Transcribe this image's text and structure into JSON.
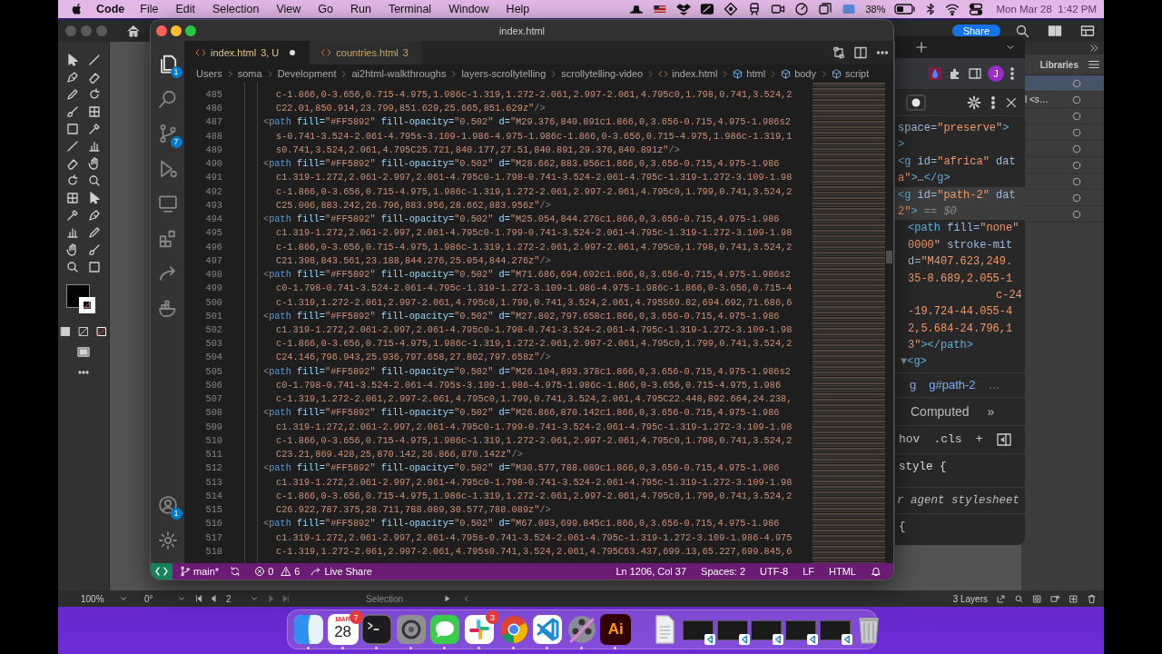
{
  "menu_bar": {
    "app": "Code",
    "menus": [
      "File",
      "Edit",
      "Selection",
      "View",
      "Go",
      "Run",
      "Terminal",
      "Window",
      "Help"
    ],
    "battery": "38%",
    "clock": "Mon Mar 28  1:42 PM"
  },
  "illustrator": {
    "share": "Share",
    "panel_title": "Libraries",
    "layers": [
      {
        "selected": true
      },
      {
        "label": "l <s…",
        "selected": false
      },
      {
        "selected": false
      },
      {
        "selected": false
      },
      {
        "selected": false
      },
      {
        "selected": false
      },
      {
        "selected": false
      },
      {
        "selected": false
      },
      {
        "selected": false
      }
    ],
    "status": {
      "zoom": "100%",
      "rotation": "0°",
      "artboard": "2",
      "tool": "Selection",
      "layers_count": "3 Layers"
    }
  },
  "browser": {
    "avatar": "J",
    "dom_lines": [
      {
        "kind": "root",
        "selected": false,
        "tokens": [
          {
            "kind": "attr",
            "text": "space="
          },
          {
            "kind": "value",
            "text": "\"preserve\""
          },
          {
            "kind": "tag",
            "text": ">"
          }
        ]
      },
      {
        "kind": "root",
        "selected": false,
        "tokens": [
          {
            "kind": "tag",
            "text": ">"
          }
        ]
      },
      {
        "kind": "root",
        "selected": false,
        "tokens": [
          {
            "kind": "tag",
            "text": "<g"
          },
          {
            "kind": "attr",
            "text": " id="
          },
          {
            "kind": "value",
            "text": "\"africa\""
          },
          {
            "kind": "attr",
            "text": " dat"
          }
        ]
      },
      {
        "kind": "root",
        "selected": false,
        "tokens": [
          {
            "kind": "value",
            "text": "a\""
          },
          {
            "kind": "tag",
            "text": ">"
          },
          {
            "kind": "punct",
            "text": "…"
          },
          {
            "kind": "tag",
            "text": "</g>"
          }
        ]
      },
      {
        "kind": "root",
        "selected": true,
        "tokens": [
          {
            "kind": "tag",
            "text": "<g"
          },
          {
            "kind": "attr",
            "text": " id="
          },
          {
            "kind": "value",
            "text": "\"path-2\""
          },
          {
            "kind": "attr",
            "text": " dat"
          }
        ]
      },
      {
        "kind": "root",
        "selected": true,
        "tokens": [
          {
            "kind": "value",
            "text": "2\""
          },
          {
            "kind": "tag",
            "text": ">"
          },
          {
            "kind": "note",
            "text": " == $0"
          }
        ]
      },
      {
        "kind": "child",
        "selected": false,
        "tokens": [
          {
            "kind": "tag",
            "text": "<path"
          },
          {
            "kind": "attr",
            "text": " fill="
          },
          {
            "kind": "value",
            "text": "\"none\""
          }
        ]
      },
      {
        "kind": "child",
        "selected": false,
        "tokens": [
          {
            "kind": "value",
            "text": "0000\""
          },
          {
            "kind": "attr",
            "text": " stroke-mit"
          }
        ]
      },
      {
        "kind": "child",
        "selected": false,
        "tokens": [
          {
            "kind": "attr",
            "text": "d="
          },
          {
            "kind": "value",
            "text": "\"M407.623,249."
          }
        ]
      },
      {
        "kind": "child",
        "selected": false,
        "tokens": [
          {
            "kind": "value",
            "text": "35-8.689,2.055-1"
          }
        ]
      },
      {
        "kind": "deep",
        "selected": false,
        "tokens": [
          {
            "kind": "value",
            "text": "c-24"
          }
        ]
      },
      {
        "kind": "child",
        "selected": false,
        "tokens": [
          {
            "kind": "value",
            "text": "-19.724-44.055-4"
          }
        ]
      },
      {
        "kind": "child",
        "selected": false,
        "tokens": [
          {
            "kind": "value",
            "text": "2,5.684-24.796,1"
          }
        ]
      },
      {
        "kind": "child",
        "selected": false,
        "tokens": [
          {
            "kind": "value",
            "text": "3\""
          },
          {
            "kind": "tag",
            "text": "></path>"
          }
        ]
      },
      {
        "kind": "arrow",
        "selected": false,
        "tokens": [
          {
            "kind": "note",
            "text": "▼"
          },
          {
            "kind": "tag",
            "text": "<g>"
          }
        ]
      }
    ],
    "crumbs": [
      "g",
      "g#path-2",
      "…"
    ],
    "pane_tab": "Computed",
    "pane_more": "»",
    "style_tools": [
      "hov",
      ".cls",
      "+"
    ],
    "style_lines": [
      {
        "kind": "rule",
        "text": "style {"
      },
      {
        "kind": "source",
        "text": "r agent stylesheet"
      },
      {
        "kind": "rule",
        "text": "{"
      }
    ]
  },
  "editor": {
    "title": "index.html",
    "activity": [
      {
        "kind": "explorer",
        "selected": true,
        "badge": "1"
      },
      {
        "kind": "search",
        "selected": false
      },
      {
        "kind": "source-control",
        "selected": false,
        "badge": "7"
      },
      {
        "kind": "run",
        "selected": false
      },
      {
        "kind": "remote",
        "selected": false
      },
      {
        "kind": "extensions",
        "selected": false
      },
      {
        "kind": "live-share",
        "selected": false
      },
      {
        "kind": "docker",
        "selected": false
      }
    ],
    "activity_bottom": [
      {
        "kind": "accounts",
        "badge": "1"
      },
      {
        "kind": "manage"
      }
    ],
    "tabs": [
      {
        "label": "index.html",
        "detail": "3, U",
        "modified": true,
        "selected": true
      },
      {
        "label": "countries.html",
        "detail": "3",
        "modified": false,
        "selected": false
      }
    ],
    "breadcrumbs": [
      {
        "kind": "folder",
        "label": "Users"
      },
      {
        "kind": "folder",
        "label": "soma"
      },
      {
        "kind": "folder",
        "label": "Development"
      },
      {
        "kind": "folder",
        "label": "ai2html-walkthroughs"
      },
      {
        "kind": "folder",
        "label": "layers-scrollytelling"
      },
      {
        "kind": "folder",
        "label": "scrollytelling-video"
      },
      {
        "kind": "file",
        "label": "index.html"
      },
      {
        "kind": "element",
        "label": "html"
      },
      {
        "kind": "element",
        "label": "body"
      },
      {
        "kind": "element",
        "label": "script"
      }
    ],
    "lines": [
      {
        "n": "485",
        "kind": "cont",
        "tokens": [
          {
            "kind": "value",
            "text": "c-1.866,0-3.656,0.715-4.975,1.986c-1.319,1.272-2.061,2.997-2.061,4.795c0,1.798,0.741,3.524,2"
          }
        ]
      },
      {
        "n": "486",
        "kind": "cont",
        "tokens": [
          {
            "kind": "value",
            "text": "C22.01,850.914,23.799,851.629,25.665,851.629z\""
          },
          {
            "kind": "punct",
            "text": "/>"
          }
        ]
      },
      {
        "n": "487",
        "kind": "open",
        "tokens": [
          {
            "kind": "punct",
            "text": "<"
          },
          {
            "kind": "tag",
            "text": "path"
          },
          {
            "kind": "attr",
            "text": " fill="
          },
          {
            "kind": "value",
            "text": "\"#FF5892\""
          },
          {
            "kind": "attr",
            "text": " fill-opacity="
          },
          {
            "kind": "value",
            "text": "\"0.502\""
          },
          {
            "kind": "attr",
            "text": " d="
          },
          {
            "kind": "value",
            "text": "\"M29.376,840.891c1.866,0,3.656-0.715,4.975-1.986s2"
          }
        ]
      },
      {
        "n": "488",
        "kind": "cont",
        "tokens": [
          {
            "kind": "value",
            "text": "s-0.741-3.524-2.061-4.795s-3.109-1.986-4.975-1.986c-1.866,0-3.656,0.715-4.975,1.986c-1.319,1"
          }
        ]
      },
      {
        "n": "489",
        "kind": "cont",
        "tokens": [
          {
            "kind": "value",
            "text": "s0.741,3.524,2.061,4.795C25.721,840.177,27.51,840.891,29.376,840.891z\""
          },
          {
            "kind": "punct",
            "text": "/>"
          }
        ]
      },
      {
        "n": "490",
        "kind": "open",
        "tokens": [
          {
            "kind": "punct",
            "text": "<"
          },
          {
            "kind": "tag",
            "text": "path"
          },
          {
            "kind": "attr",
            "text": " fill="
          },
          {
            "kind": "value",
            "text": "\"#FF5892\""
          },
          {
            "kind": "attr",
            "text": " fill-opacity="
          },
          {
            "kind": "value",
            "text": "\"0.502\""
          },
          {
            "kind": "attr",
            "text": " d="
          },
          {
            "kind": "value",
            "text": "\"M28.662,883.956c1.866,0,3.656-0.715,4.975-1.986"
          }
        ]
      },
      {
        "n": "491",
        "kind": "cont",
        "tokens": [
          {
            "kind": "value",
            "text": "c1.319-1.272,2.061-2.997,2.061-4.795c0-1.798-0.741-3.524-2.061-4.795c-1.319-1.272-3.109-1.98"
          }
        ]
      },
      {
        "n": "492",
        "kind": "cont",
        "tokens": [
          {
            "kind": "value",
            "text": "c-1.866,0-3.656,0.715-4.975,1.986c-1.319,1.272-2.061,2.997-2.061,4.795c0,1.799,0.741,3.524,2"
          }
        ]
      },
      {
        "n": "493",
        "kind": "cont",
        "tokens": [
          {
            "kind": "value",
            "text": "C25.006,883.242,26.796,883.956,28.662,883.956z\""
          },
          {
            "kind": "punct",
            "text": "/>"
          }
        ]
      },
      {
        "n": "494",
        "kind": "open",
        "tokens": [
          {
            "kind": "punct",
            "text": "<"
          },
          {
            "kind": "tag",
            "text": "path"
          },
          {
            "kind": "attr",
            "text": " fill="
          },
          {
            "kind": "value",
            "text": "\"#FF5892\""
          },
          {
            "kind": "attr",
            "text": " fill-opacity="
          },
          {
            "kind": "value",
            "text": "\"0.502\""
          },
          {
            "kind": "attr",
            "text": " d="
          },
          {
            "kind": "value",
            "text": "\"M25.054,844.276c1.866,0,3.656-0.715,4.975-1.986"
          }
        ]
      },
      {
        "n": "495",
        "kind": "cont",
        "tokens": [
          {
            "kind": "value",
            "text": "c1.319-1.272,2.061-2.997,2.061-4.795c0-1.799-0.741-3.524-2.061-4.795c-1.319-1.272-3.109-1.98"
          }
        ]
      },
      {
        "n": "496",
        "kind": "cont",
        "tokens": [
          {
            "kind": "value",
            "text": "c-1.866,0-3.656,0.715-4.975,1.986c-1.319,1.272-2.061,2.997-2.061,4.795c0,1.798,0.741,3.524,2"
          }
        ]
      },
      {
        "n": "497",
        "kind": "cont",
        "tokens": [
          {
            "kind": "value",
            "text": "C21.398,843.561,23.188,844.276,25.054,844.276z\""
          },
          {
            "kind": "punct",
            "text": "/>"
          }
        ]
      },
      {
        "n": "498",
        "kind": "open",
        "tokens": [
          {
            "kind": "punct",
            "text": "<"
          },
          {
            "kind": "tag",
            "text": "path"
          },
          {
            "kind": "attr",
            "text": " fill="
          },
          {
            "kind": "value",
            "text": "\"#FF5892\""
          },
          {
            "kind": "attr",
            "text": " fill-opacity="
          },
          {
            "kind": "value",
            "text": "\"0.502\""
          },
          {
            "kind": "attr",
            "text": " d="
          },
          {
            "kind": "value",
            "text": "\"M71.686,694.692c1.866,0,3.656-0.715,4.975-1.986s2"
          }
        ]
      },
      {
        "n": "499",
        "kind": "cont",
        "tokens": [
          {
            "kind": "value",
            "text": "c0-1.798-0.741-3.524-2.061-4.795c-1.319-1.272-3.109-1.986-4.975-1.986c-1.866,0-3.656,0.715-4"
          }
        ]
      },
      {
        "n": "500",
        "kind": "cont",
        "tokens": [
          {
            "kind": "value",
            "text": "c-1.319,1.272-2.061,2.997-2.061,4.795c0,1.799,0.741,3.524,2.061,4.795S69.82,694.692,71.686,6"
          }
        ]
      },
      {
        "n": "501",
        "kind": "open",
        "tokens": [
          {
            "kind": "punct",
            "text": "<"
          },
          {
            "kind": "tag",
            "text": "path"
          },
          {
            "kind": "attr",
            "text": " fill="
          },
          {
            "kind": "value",
            "text": "\"#FF5892\""
          },
          {
            "kind": "attr",
            "text": " fill-opacity="
          },
          {
            "kind": "value",
            "text": "\"0.502\""
          },
          {
            "kind": "attr",
            "text": " d="
          },
          {
            "kind": "value",
            "text": "\"M27.802,797.658c1.866,0,3.656-0.715,4.975-1.986"
          }
        ]
      },
      {
        "n": "502",
        "kind": "cont",
        "tokens": [
          {
            "kind": "value",
            "text": "c1.319-1.272,2.061-2.997,2.061-4.795c0-1.798-0.741-3.524-2.061-4.795c-1.319-1.272-3.109-1.98"
          }
        ]
      },
      {
        "n": "503",
        "kind": "cont",
        "tokens": [
          {
            "kind": "value",
            "text": "c-1.866,0-3.656,0.715-4.975,1.986c-1.319,1.272-2.061,2.997-2.061,4.795c0,1.799,0.741,3.524,2"
          }
        ]
      },
      {
        "n": "504",
        "kind": "cont",
        "tokens": [
          {
            "kind": "value",
            "text": "C24.146,796.943,25.936,797.658,27.802,797.658z\""
          },
          {
            "kind": "punct",
            "text": "/>"
          }
        ]
      },
      {
        "n": "505",
        "kind": "open",
        "tokens": [
          {
            "kind": "punct",
            "text": "<"
          },
          {
            "kind": "tag",
            "text": "path"
          },
          {
            "kind": "attr",
            "text": " fill="
          },
          {
            "kind": "value",
            "text": "\"#FF5892\""
          },
          {
            "kind": "attr",
            "text": " fill-opacity="
          },
          {
            "kind": "value",
            "text": "\"0.502\""
          },
          {
            "kind": "attr",
            "text": " d="
          },
          {
            "kind": "value",
            "text": "\"M26.104,893.378c1.866,0,3.656-0.715,4.975-1.986s2"
          }
        ]
      },
      {
        "n": "506",
        "kind": "cont",
        "tokens": [
          {
            "kind": "value",
            "text": "c0-1.798-0.741-3.524-2.061-4.795s-3.109-1.986-4.975-1.986c-1.866,0-3.656,0.715-4.975,1.986"
          }
        ]
      },
      {
        "n": "507",
        "kind": "cont",
        "tokens": [
          {
            "kind": "value",
            "text": "c-1.319,1.272-2.061,2.997-2.061,4.795c0,1.799,0.741,3.524,2.061,4.795C22.448,892.664,24.238,"
          }
        ]
      },
      {
        "n": "508",
        "kind": "open",
        "tokens": [
          {
            "kind": "punct",
            "text": "<"
          },
          {
            "kind": "tag",
            "text": "path"
          },
          {
            "kind": "attr",
            "text": " fill="
          },
          {
            "kind": "value",
            "text": "\"#FF5892\""
          },
          {
            "kind": "attr",
            "text": " fill-opacity="
          },
          {
            "kind": "value",
            "text": "\"0.502\""
          },
          {
            "kind": "attr",
            "text": " d="
          },
          {
            "kind": "value",
            "text": "\"M26.866,870.142c1.866,0,3.656-0.715,4.975-1.986"
          }
        ]
      },
      {
        "n": "509",
        "kind": "cont",
        "tokens": [
          {
            "kind": "value",
            "text": "c1.319-1.272,2.061-2.997,2.061-4.795c0-1.799-0.741-3.524-2.061-4.795c-1.319-1.272-3.109-1.98"
          }
        ]
      },
      {
        "n": "510",
        "kind": "cont",
        "tokens": [
          {
            "kind": "value",
            "text": "c-1.866,0-3.656,0.715-4.975,1.986c-1.319,1.272-2.061,2.997-2.061,4.795c0,1.798,0.741,3.524,2"
          }
        ]
      },
      {
        "n": "511",
        "kind": "cont",
        "tokens": [
          {
            "kind": "value",
            "text": "C23.21,869.428,25,870.142,26.866,870.142z\""
          },
          {
            "kind": "punct",
            "text": "/>"
          }
        ]
      },
      {
        "n": "512",
        "kind": "open",
        "tokens": [
          {
            "kind": "punct",
            "text": "<"
          },
          {
            "kind": "tag",
            "text": "path"
          },
          {
            "kind": "attr",
            "text": " fill="
          },
          {
            "kind": "value",
            "text": "\"#FF5892\""
          },
          {
            "kind": "attr",
            "text": " fill-opacity="
          },
          {
            "kind": "value",
            "text": "\"0.502\""
          },
          {
            "kind": "attr",
            "text": " d="
          },
          {
            "kind": "value",
            "text": "\"M30.577,788.089c1.866,0,3.656-0.715,4.975-1.986"
          }
        ]
      },
      {
        "n": "513",
        "kind": "cont",
        "tokens": [
          {
            "kind": "value",
            "text": "c1.319-1.272,2.061-2.997,2.061-4.795c0-1.798-0.741-3.524-2.061-4.795c-1.319-1.272-3.109-1.98"
          }
        ]
      },
      {
        "n": "514",
        "kind": "cont",
        "tokens": [
          {
            "kind": "value",
            "text": "c-1.866,0-3.656,0.715-4.975,1.986c-1.319,1.272-2.061,2.997-2.061,4.795c0,1.799,0.741,3.524,2"
          }
        ]
      },
      {
        "n": "515",
        "kind": "cont",
        "tokens": [
          {
            "kind": "value",
            "text": "C26.922,787.375,28.711,788.089,30.577,788.089z\""
          },
          {
            "kind": "punct",
            "text": "/>"
          }
        ]
      },
      {
        "n": "516",
        "kind": "open",
        "tokens": [
          {
            "kind": "punct",
            "text": "<"
          },
          {
            "kind": "tag",
            "text": "path"
          },
          {
            "kind": "attr",
            "text": " fill="
          },
          {
            "kind": "value",
            "text": "\"#FF5892\""
          },
          {
            "kind": "attr",
            "text": " fill-opacity="
          },
          {
            "kind": "value",
            "text": "\"0.502\""
          },
          {
            "kind": "attr",
            "text": " d="
          },
          {
            "kind": "value",
            "text": "\"M67.093,699.845c1.866,0,3.656-0.715,4.975-1.986"
          }
        ]
      },
      {
        "n": "517",
        "kind": "cont",
        "tokens": [
          {
            "kind": "value",
            "text": "c1.319-1.272,2.061-2.997,2.061-4.795s-0.741-3.524-2.061-4.795c-1.319-1.272-3.109-1.986-4.975"
          }
        ]
      },
      {
        "n": "518",
        "kind": "cont",
        "tokens": [
          {
            "kind": "value",
            "text": "c-1.319,1.272-2.061,2.997-2.061,4.795s0.741,3.524,2.061,4.795C63.437,699.13,65.227,699.845,6"
          }
        ]
      }
    ],
    "status_bar": {
      "branch": "main*",
      "errors": "0",
      "warnings": "6",
      "live_share": "Live Share",
      "position": "Ln 1206, Col 37",
      "spaces": "Spaces: 2",
      "encoding": "UTF-8",
      "eol": "LF",
      "language": "HTML"
    }
  },
  "dock": {
    "apps": [
      {
        "kind": "finder",
        "running": true
      },
      {
        "kind": "calendar",
        "month": "MAR",
        "day": "28",
        "badge": "7",
        "running": true
      },
      {
        "kind": "terminal",
        "running": true
      },
      {
        "kind": "settings",
        "running": true
      },
      {
        "kind": "messages",
        "running": true
      },
      {
        "kind": "slack",
        "badge": "3",
        "running": true
      },
      {
        "kind": "chrome",
        "running": true
      },
      {
        "kind": "vscode",
        "running": true
      },
      {
        "kind": "media",
        "running": true
      },
      {
        "kind": "illustrator",
        "label": "Ai",
        "running": true
      }
    ],
    "others": [
      {
        "kind": "document"
      },
      {
        "kind": "window"
      },
      {
        "kind": "window"
      },
      {
        "kind": "window"
      },
      {
        "kind": "window"
      },
      {
        "kind": "window"
      },
      {
        "kind": "trash"
      }
    ]
  }
}
